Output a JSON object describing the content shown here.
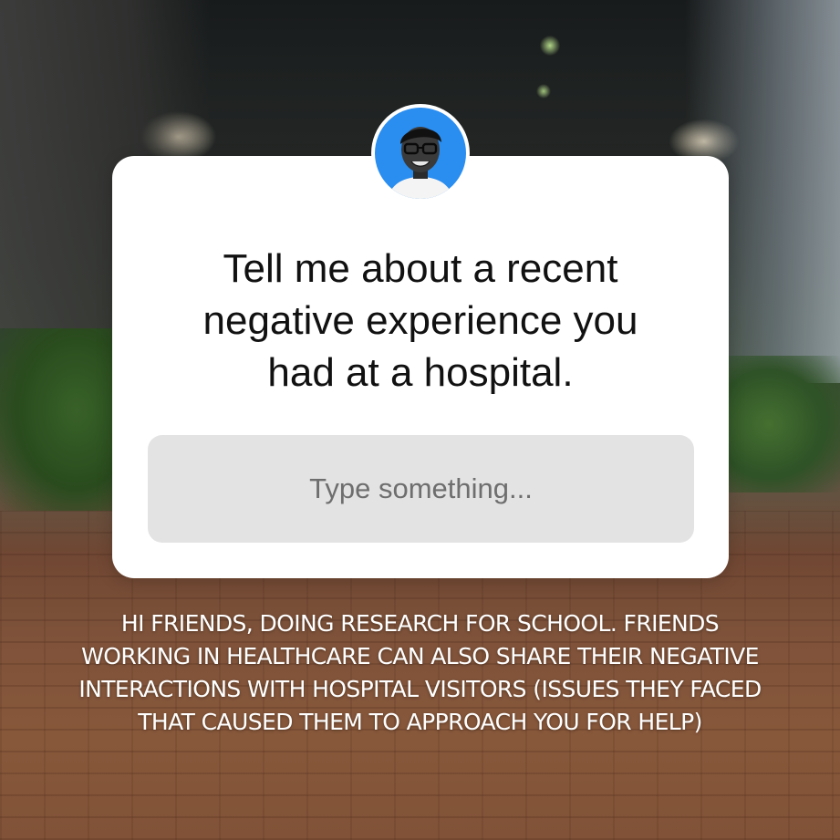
{
  "story": {
    "question_sticker": {
      "question": "Tell me about a recent\nnegative experience you\nhad at a hospital.",
      "answer_placeholder": "Type something..."
    },
    "caption": "HI FRIENDS, DOING RESEARCH FOR SCHOOL. FRIENDS\nWORKING IN HEALTHCARE CAN ALSO SHARE THEIR NEGATIVE\nINTERACTIONS WITH HOSPITAL VISITORS (ISSUES THEY FACED\nTHAT CAUSED THEM TO APPROACH YOU FOR HELP)"
  },
  "colors": {
    "card_background": "#ffffff",
    "answer_field_background": "#e3e3e3",
    "avatar_background": "#2a8df0",
    "caption_text": "#ffffff"
  },
  "icons": {
    "avatar": "profile-photo-icon"
  }
}
